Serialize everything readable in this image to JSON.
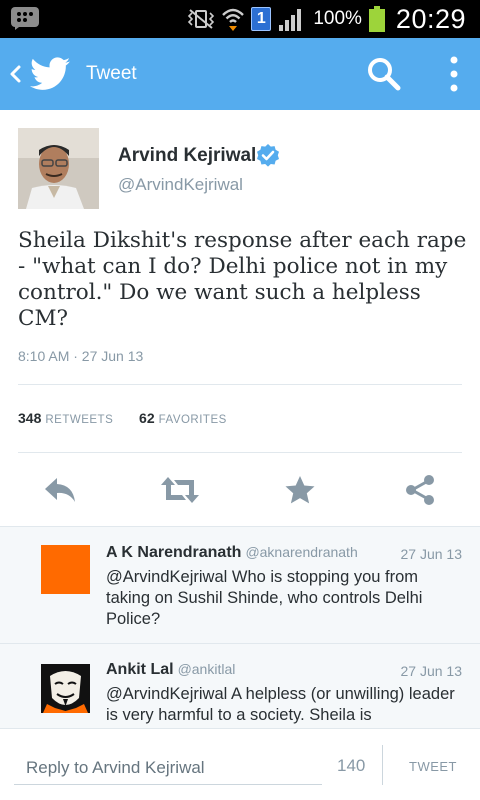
{
  "status_bar": {
    "sim_badge": "1",
    "battery_percent": "100%",
    "time": "20:29",
    "battery_level": 1.0
  },
  "action_bar": {
    "title": "Tweet",
    "back_icon": "chevron-left-icon",
    "logo_icon": "twitter-bird-icon",
    "search_icon": "search-icon",
    "more_icon": "overflow-menu-icon"
  },
  "tweet": {
    "author_name": "Arvind Kejriwal",
    "author_handle": "@ArvindKejriwal",
    "text": "Sheila Dikshit's response after each rape - \"what can I do? Delhi police not in my control.\" Do we want such a helpless CM?",
    "timestamp": "8:10 AM · 27 Jun 13",
    "retweets_count": "348",
    "retweets_label": "RETWEETS",
    "favorites_count": "62",
    "favorites_label": "FAVORITES"
  },
  "replies": [
    {
      "name": "A K Narendranath",
      "handle": "@aknarendranath",
      "date": "27 Jun 13",
      "text": "@ArvindKejriwal Who is stopping you from taking on Sushil Shinde, who controls Delhi Police?"
    },
    {
      "name": "Ankit Lal",
      "handle": "@ankitlal",
      "date": "27 Jun 13",
      "text": "@ArvindKejriwal A helpless (or unwilling) leader is very harmful to a society. Sheila is"
    }
  ],
  "compose": {
    "placeholder": "Reply to Arvind Kejriwal",
    "char_count": "140",
    "tweet_button": "TWEET"
  },
  "colors": {
    "brand": "#55acee",
    "text": "#292f33",
    "muted": "#8899a6",
    "action_icon": "#8899a6",
    "verified": "#55acee",
    "battery": "#9dd43a"
  }
}
